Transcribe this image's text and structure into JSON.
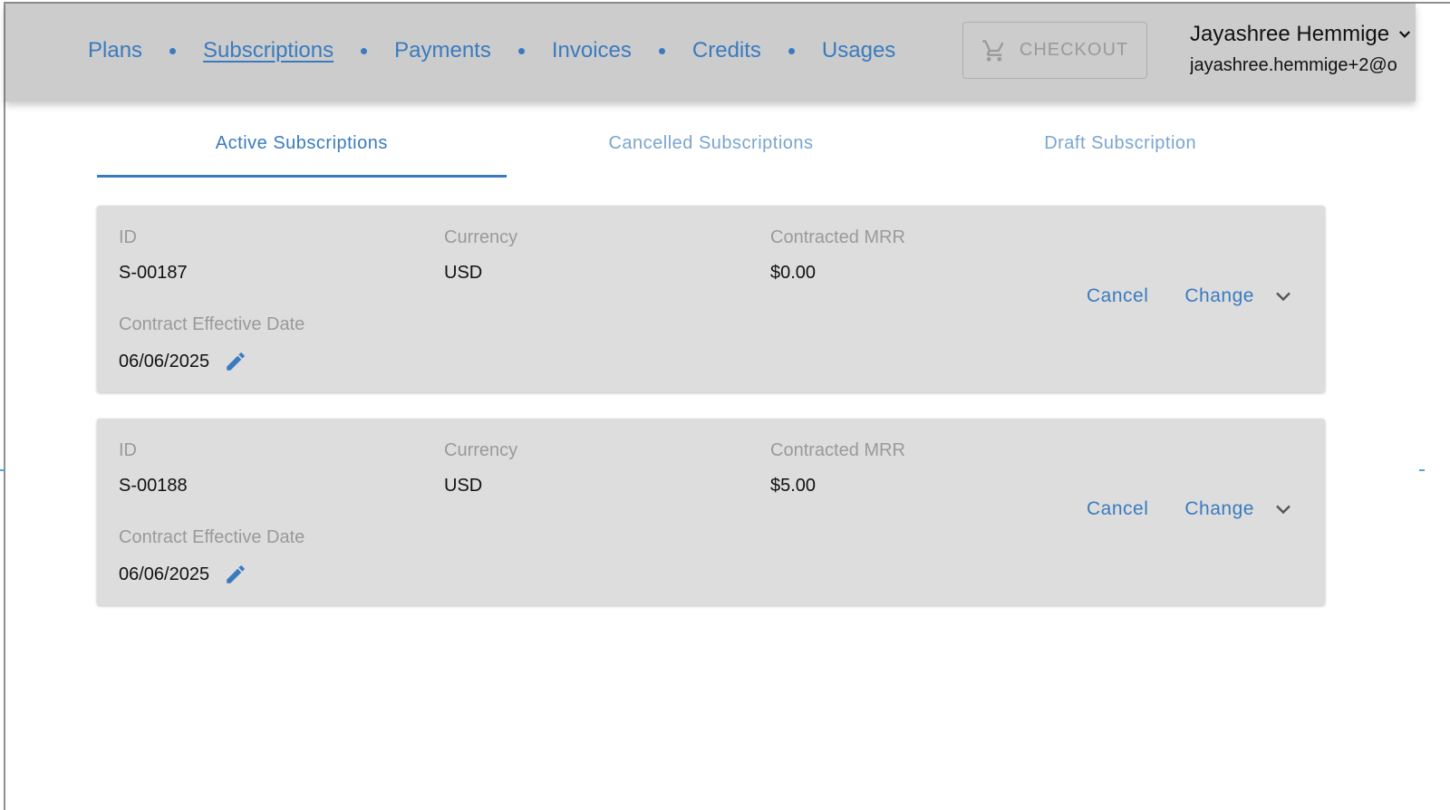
{
  "header": {
    "nav": [
      "Plans",
      "Subscriptions",
      "Payments",
      "Invoices",
      "Credits",
      "Usages"
    ],
    "active_nav": "Subscriptions",
    "checkout_label": "CHECKOUT",
    "checkout_icon": "cart-icon",
    "user_name": "Jayashree Hemmige",
    "user_email": "jayashree.hemmige+2@o"
  },
  "tabs": {
    "active": "Active Subscriptions",
    "cancelled": "Cancelled Subscriptions",
    "draft": "Draft Subscription"
  },
  "labels": {
    "id": "ID",
    "currency": "Currency",
    "mrr": "Contracted MRR",
    "effective_date": "Contract Effective Date",
    "cancel": "Cancel",
    "change": "Change"
  },
  "subscriptions": [
    {
      "id": "S-00187",
      "currency": "USD",
      "mrr": "$0.00",
      "effective_date": "06/06/2025"
    },
    {
      "id": "S-00188",
      "currency": "USD",
      "mrr": "$5.00",
      "effective_date": "06/06/2025"
    }
  ],
  "colors": {
    "accent": "#3a7bbf",
    "header_bg": "#cccccc",
    "card_bg": "#dddddd",
    "label_text": "#9a9a9a"
  }
}
